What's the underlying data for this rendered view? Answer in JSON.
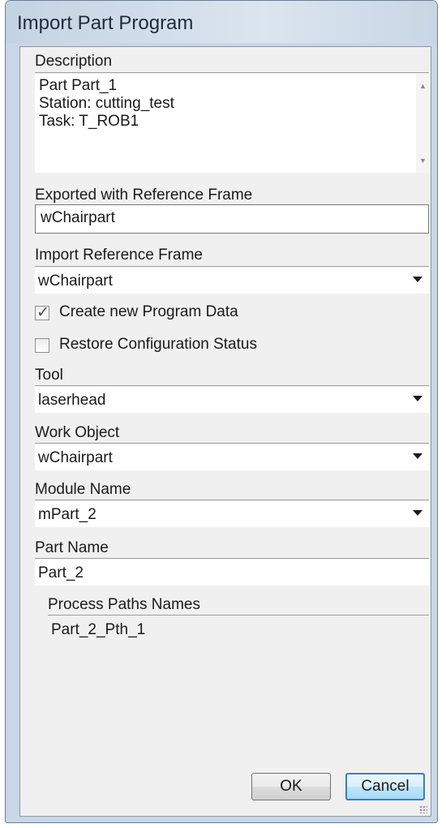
{
  "window": {
    "title": "Import Part Program"
  },
  "description": {
    "label": "Description",
    "lines": [
      "Part Part_1",
      "Station: cutting_test",
      "Task: T_ROB1"
    ]
  },
  "exported_frame": {
    "label": "Exported with Reference Frame",
    "value": "wChairpart"
  },
  "import_frame": {
    "label": "Import Reference Frame",
    "value": "wChairpart"
  },
  "create_program_data": {
    "label": "Create new Program Data",
    "checked": true
  },
  "restore_config": {
    "label": "Restore Configuration Status",
    "checked": false
  },
  "tool": {
    "label": "Tool",
    "value": "laserhead"
  },
  "work_object": {
    "label": "Work Object",
    "value": "wChairpart"
  },
  "module_name": {
    "label": "Module Name",
    "value": "mPart_2"
  },
  "part_name": {
    "label": "Part Name",
    "value": "Part_2"
  },
  "process_paths": {
    "label": "Process Paths Names",
    "items": [
      "Part_2_Pth_1"
    ]
  },
  "buttons": {
    "ok": "OK",
    "cancel": "Cancel"
  },
  "icons": {
    "check": "checkmark-icon",
    "dropdown": "chevron-down-icon"
  },
  "colors": {
    "dialog_bg": "#f0f0f0",
    "frame": "#c9d7e6",
    "default_button_border": "#3c7fb1"
  }
}
